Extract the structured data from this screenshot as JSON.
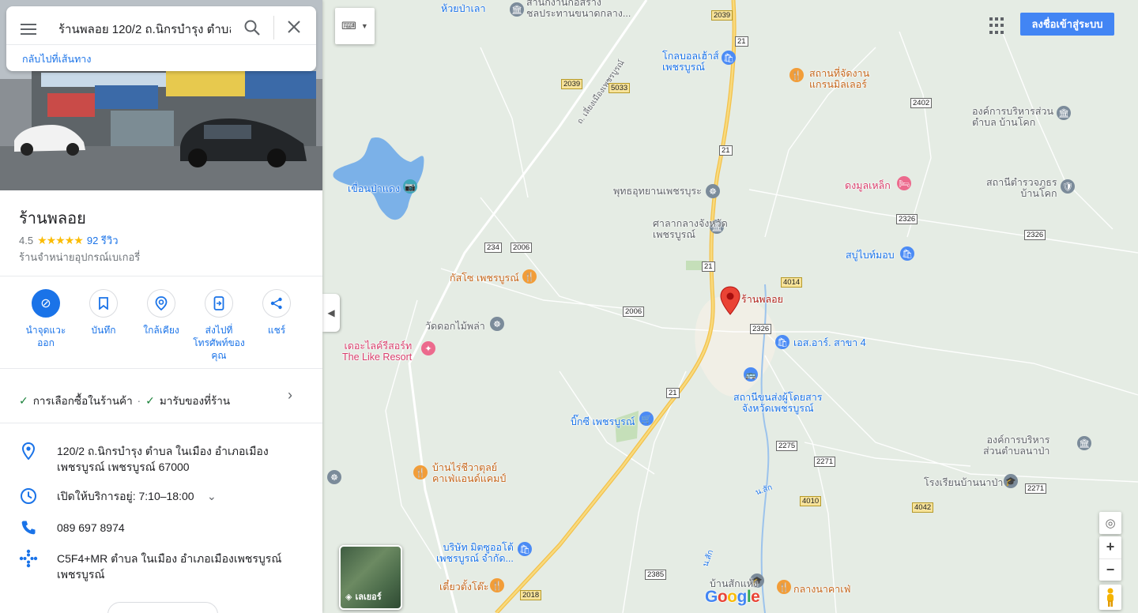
{
  "search": {
    "value": "ร้านพลอย 120/2 ถ.นิกรบำรุง ตำบล",
    "back_link": "กลับไปที่เส้นทาง"
  },
  "place": {
    "name": "ร้านพลอย",
    "rating": "4.5",
    "stars": "★★★★★",
    "reviews": "92 รีวิว",
    "category": "ร้านจำหน่ายอุปกรณ์เบเกอรี่"
  },
  "actions": [
    {
      "label": "นำจุดแวะออก",
      "icon": "remove-stop-icon"
    },
    {
      "label": "บันทึก",
      "icon": "bookmark-icon"
    },
    {
      "label": "ใกล้เคียง",
      "icon": "nearby-icon"
    },
    {
      "label": "ส่งไปที่โทรศัพท์ของคุณ",
      "icon": "send-to-phone-icon"
    },
    {
      "label": "แชร์",
      "icon": "share-icon"
    }
  ],
  "options": {
    "item1": "การเลือกซื้อในร้านค้า",
    "dot": "·",
    "item2": "มารับของที่ร้าน"
  },
  "info": {
    "address": "120/2 ถ.นิกรบำรุง ตำบล ในเมือง อำเภอเมืองเพชรบูรณ์ เพชรบูรณ์ 67000",
    "hours": "เปิดให้บริการอยู่:  7:10–18:00",
    "phone": "089 697 8974",
    "plus_code": "C5F4+MR ตำบล ในเมือง อำเภอเมืองเพชรบูรณ์ เพชรบูรณ์"
  },
  "map": {
    "signin": "ลงชื่อเข้าสู่ระบบ",
    "layers": "เลเยอร์",
    "google": "Google",
    "labels": {
      "l1": "ห้วยป่าเลา",
      "l2": "สำนักงานก่อสร้าง\nชลประทานขนาดกลาง...",
      "l3": "โกลบอลเฮ้าส์\nเพชรบูรณ์",
      "l4": "สถานที่จัดงาน\nแกรนมิลเลอร์",
      "l5": "องค์การบริหารส่วน\nตำบล บ้านโคก",
      "l6": "ดงมูลเหล็ก",
      "l7": "สถานีตำรวจภูธร\nบ้านโคก",
      "l8": "เขื่อนป่าแดง",
      "l9": "พุทธอุทยานเพชรบุระ",
      "l10": "ศาลากลางจังหวัด\nเพชรบูรณ์",
      "l11": "สบู่ไบท์มอบ",
      "l12": "กัสโซ เพชรบูรณ์",
      "l13": "ร้านพลอย",
      "l14": "วัดดอกไม้พล่า",
      "l15": "เดอะไลค์รีสอร์ท\nThe Like Resort",
      "l16": "เอส.อาร์. สาขา 4",
      "l17": "สถานีขนส่งผู้โดยสาร\nจังหวัดเพชรบูรณ์",
      "l18": "บิ๊กซี เพชรบูรณ์",
      "l19": "องค์การบริหาร\nส่วนตำบลนาป่า",
      "l20": "บ้านไร่ชีวาตุลย์\nคาเฟ่แอนด์แคมป์",
      "l21": "โรงเรียนบ้านนาป่า",
      "l22": "น.สัก",
      "l23": "บริษัท มิตซูออโต้\nเพชรบูรณ์ จำกัด...",
      "l24": "บ้านสักแห้ง",
      "l25": "เตี๋ยวตั้งโต๊ะ",
      "l26": "กลางนาคาเฟ่",
      "l27": "ถ. เลี่ยงเมืองเพชรบูรณ์",
      "l28": "น.สัก"
    },
    "shields": {
      "s2039a": "2039",
      "s21a": "21",
      "s2039b": "2039",
      "s5033": "5033",
      "s2402": "2402",
      "s21b": "21",
      "s2326a": "2326",
      "s2326b": "2326",
      "s234": "234",
      "s2006a": "2006",
      "s21c": "21",
      "s4014": "4014",
      "s2006b": "2006",
      "s2326c": "2326",
      "s21d": "21",
      "s2275": "2275",
      "s2271a": "2271",
      "s2271b": "2271",
      "s4010": "4010",
      "s4042": "4042",
      "s2385": "2385",
      "s2018": "2018"
    }
  }
}
